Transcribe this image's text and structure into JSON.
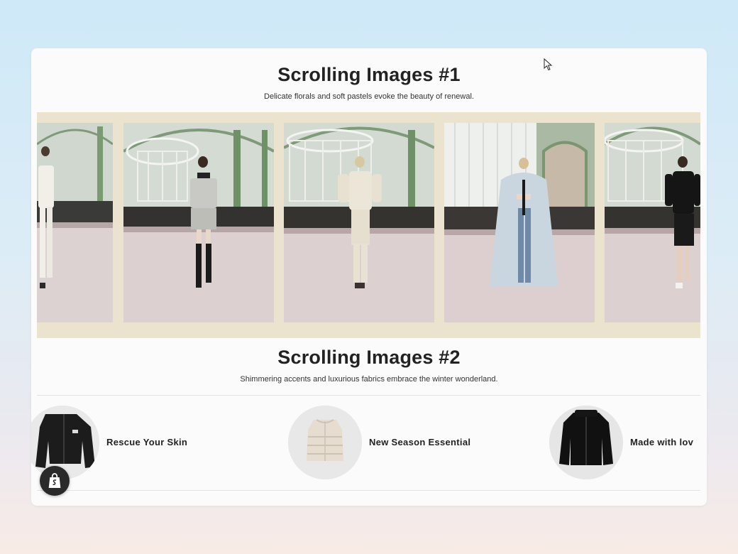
{
  "section1": {
    "title": "Scrolling Images #1",
    "subtitle": "Delicate florals and soft pastels evoke the beauty of renewal.",
    "frames": [
      {
        "look": "white-jacket-look"
      },
      {
        "look": "tweed-skirt-suit-look"
      },
      {
        "look": "cream-suit-look"
      },
      {
        "look": "pale-blue-feather-coat-look"
      },
      {
        "look": "black-dress-look"
      }
    ]
  },
  "section2": {
    "title": "Scrolling Images #2",
    "subtitle": "Shimmering accents and luxurious fabrics embrace the winter wonderland.",
    "items": [
      {
        "label": "Rescue Your Skin",
        "product": "black-cropped-jacket"
      },
      {
        "label": "New Season Essential",
        "product": "cream-puffer-vest"
      },
      {
        "label": "Made with lov",
        "product": "black-fleece-jacket"
      }
    ]
  },
  "colors": {
    "strip_background": "#ebe3cd",
    "card_background": "#fbfbfb",
    "title_text": "#222222"
  },
  "icons": {
    "cursor": "mouse-pointer-icon",
    "badge": "shopify-bag-icon"
  }
}
